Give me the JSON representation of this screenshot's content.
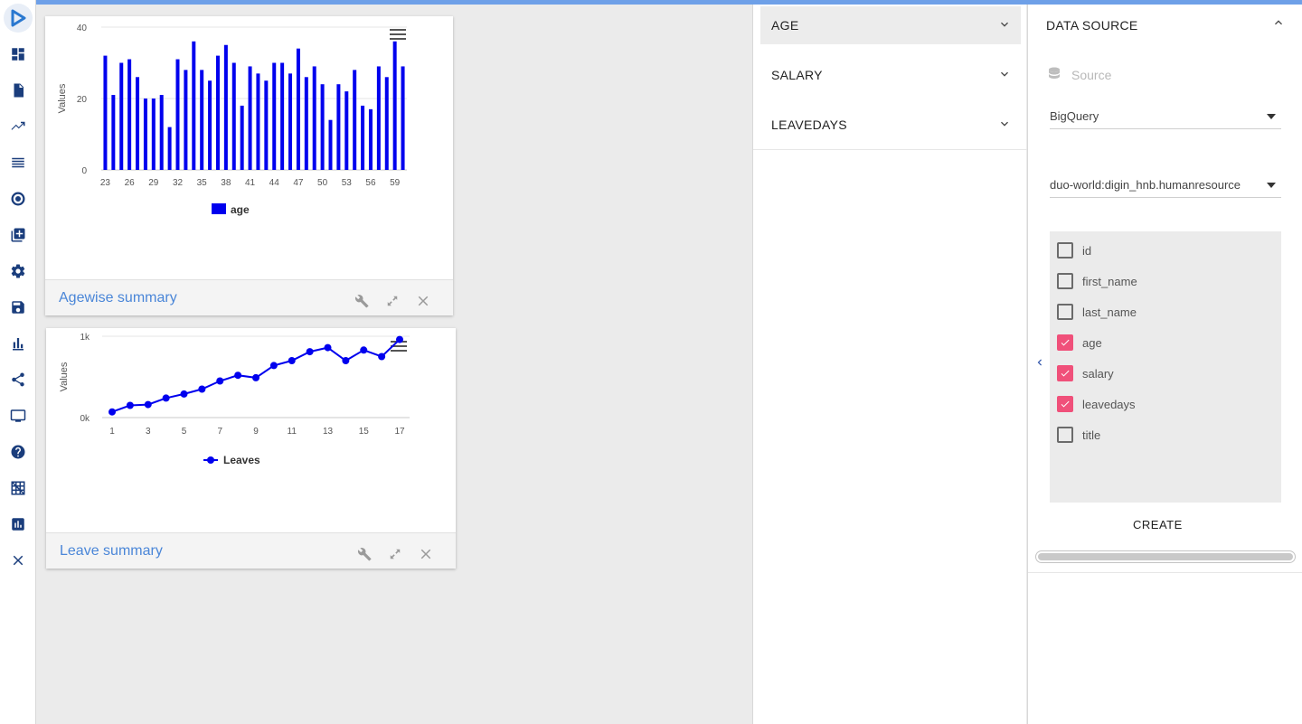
{
  "nav": {
    "items": [
      "dashboard-icon",
      "report-icon",
      "trend-icon",
      "list-icon",
      "target-icon",
      "add-library-icon",
      "settings-icon",
      "save-icon",
      "bar-chart-icon",
      "share-icon",
      "monitor-icon",
      "help-icon",
      "grid-icon",
      "insights-icon",
      "close-icon"
    ]
  },
  "widgets": [
    {
      "title": "Agewise summary"
    },
    {
      "title": "Leave summary"
    }
  ],
  "accordion": {
    "items": [
      "AGE",
      "SALARY",
      "LEAVEDAYS"
    ]
  },
  "datasource": {
    "header": "DATA SOURCE",
    "source_placeholder": "Source",
    "source_value": "BigQuery",
    "table_value": "duo-world:digin_hnb.humanresource",
    "fields": [
      {
        "name": "id",
        "checked": false
      },
      {
        "name": "first_name",
        "checked": false
      },
      {
        "name": "last_name",
        "checked": false
      },
      {
        "name": "age",
        "checked": true
      },
      {
        "name": "salary",
        "checked": true
      },
      {
        "name": "leavedays",
        "checked": true
      },
      {
        "name": "title",
        "checked": false
      }
    ],
    "create_label": "CREATE"
  },
  "chart_data": [
    {
      "type": "bar",
      "ylabel": "Values",
      "ylim": [
        0,
        40
      ],
      "yticks": [
        "0",
        "20",
        "40"
      ],
      "categories": [
        23,
        24,
        25,
        26,
        27,
        28,
        29,
        30,
        31,
        32,
        33,
        34,
        35,
        36,
        37,
        38,
        39,
        40,
        41,
        42,
        43,
        44,
        45,
        46,
        47,
        48,
        49,
        50,
        51,
        52,
        53,
        54,
        55,
        56,
        57,
        58,
        59,
        60
      ],
      "tick_labels": [
        "23",
        "26",
        "29",
        "32",
        "35",
        "38",
        "41",
        "44",
        "47",
        "50",
        "53",
        "56",
        "59"
      ],
      "series": [
        {
          "name": "age",
          "values": [
            32,
            21,
            30,
            31,
            26,
            20,
            20,
            21,
            12,
            31,
            28,
            36,
            28,
            25,
            32,
            35,
            30,
            18,
            29,
            27,
            25,
            30,
            30,
            27,
            34,
            26,
            29,
            24,
            14,
            24,
            22,
            28,
            18,
            17,
            29,
            26,
            36,
            29
          ]
        }
      ],
      "color": "#0000ee",
      "legend": "bottom",
      "grid": true
    },
    {
      "type": "line",
      "ylabel": "Values",
      "ylim": [
        0,
        1000
      ],
      "yticks": [
        "0k",
        "1k"
      ],
      "x": [
        1,
        2,
        3,
        4,
        5,
        6,
        7,
        8,
        9,
        10,
        11,
        12,
        13,
        14,
        15,
        16,
        17
      ],
      "tick_labels": [
        "1",
        "3",
        "5",
        "7",
        "9",
        "11",
        "13",
        "15",
        "17"
      ],
      "series": [
        {
          "name": "Leaves",
          "values": [
            70,
            150,
            160,
            240,
            290,
            350,
            450,
            520,
            490,
            640,
            700,
            810,
            860,
            700,
            830,
            750,
            960
          ]
        }
      ],
      "color": "#0000ee",
      "legend": "bottom",
      "grid": true
    }
  ]
}
